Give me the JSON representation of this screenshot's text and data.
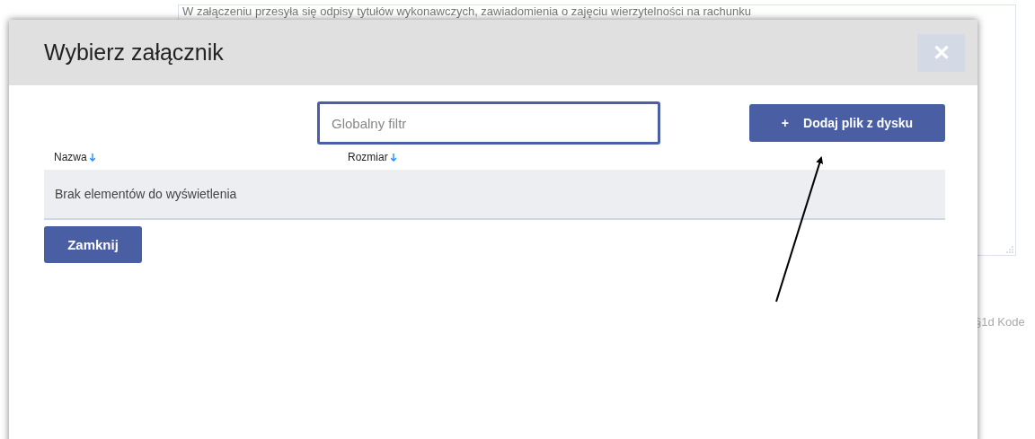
{
  "background": {
    "textarea_text": "W załączeniu przesyła się odpisy tytułów wykonawczych, zawiadomienia o zajęciu wierzytelności na rachunku",
    "side_text": "§1d Kode"
  },
  "dialog": {
    "title": "Wybierz załącznik",
    "close_label": "✕",
    "filter": {
      "placeholder": "Globalny filtr"
    },
    "add_button": {
      "icon": "+",
      "label": "Dodaj plik z dysku"
    },
    "table": {
      "columns": [
        {
          "label": "Nazwa",
          "sorted": true
        },
        {
          "label": "Rozmiar",
          "sorted": true
        }
      ],
      "empty_message": "Brak elementów do wyświetlenia"
    },
    "close_button": "Zamknij"
  },
  "annotation": {
    "kind": "arrow"
  }
}
